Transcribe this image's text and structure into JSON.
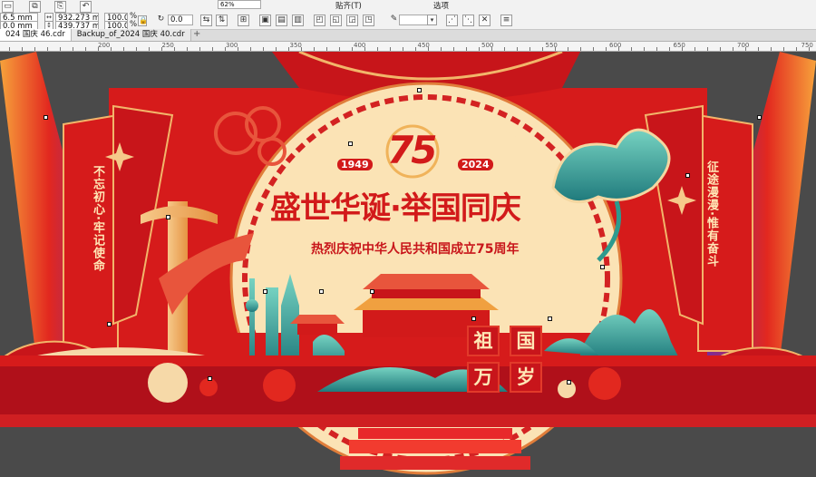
{
  "toolbar": {
    "x_pos": "6.5 mm",
    "y_pos": "0.0 mm",
    "width": "932.273 mm",
    "height": "439.737 mm",
    "scale_x": "100.0",
    "scale_y": "100.0",
    "pct": "%",
    "rotation": "0.0",
    "zoom": "62%",
    "snap_menu": "贴齐(T)",
    "settings_menu": "选项"
  },
  "tabs": [
    {
      "label": "024 国庆 46.cdr",
      "active": true
    },
    {
      "label": "Backup_of_2024 国庆 40.cdr",
      "active": false
    }
  ],
  "ruler": {
    "labels": [
      "200",
      "250",
      "300",
      "350",
      "400",
      "450",
      "500",
      "550",
      "600",
      "650",
      "700",
      "750"
    ]
  },
  "artwork": {
    "badge_number": "75",
    "year_left": "1949",
    "year_right": "2024",
    "title": "盛世华诞·举国同庆",
    "subtitle": "热烈庆祝中华人民共和国成立75周年",
    "left_banner": "不忘初心·牢记使命",
    "right_banner": "征途漫漫·惟有奋斗",
    "seal_chars": [
      "祖",
      "国",
      "万",
      "岁"
    ]
  },
  "colors": {
    "background": "#4a4a4a",
    "red": "#d21a1a",
    "deep_red": "#b0101a",
    "cream": "#fbe3b5",
    "gold": "#f0b35a",
    "teal": "#2e9a8e"
  }
}
